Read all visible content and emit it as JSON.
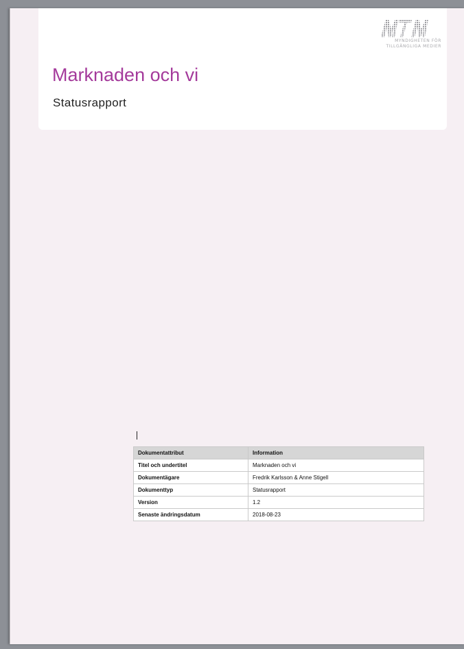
{
  "logo": {
    "line1": "MYNDIGHETEN FÖR",
    "line2": "TILLGÄNGLIGA MEDIER"
  },
  "document": {
    "title": "Marknaden och vi",
    "subtitle": "Statusrapport"
  },
  "table": {
    "headers": [
      "Dokumentattribut",
      "Information"
    ],
    "rows": [
      {
        "attribute": "Titel och undertitel",
        "information": "Marknaden och vi"
      },
      {
        "attribute": "Dokumentägare",
        "information": "Fredrik Karlsson & Anne Stigell"
      },
      {
        "attribute": "Dokumenttyp",
        "information": "Statusrapport"
      },
      {
        "attribute": "Version",
        "information": "1.2"
      },
      {
        "attribute": "Senaste ändringsdatum",
        "information": "2018-08-23"
      }
    ]
  },
  "colors": {
    "title": "#a43a9b",
    "page_background": "#f6eff3",
    "table_header": "#d6d6d6"
  }
}
